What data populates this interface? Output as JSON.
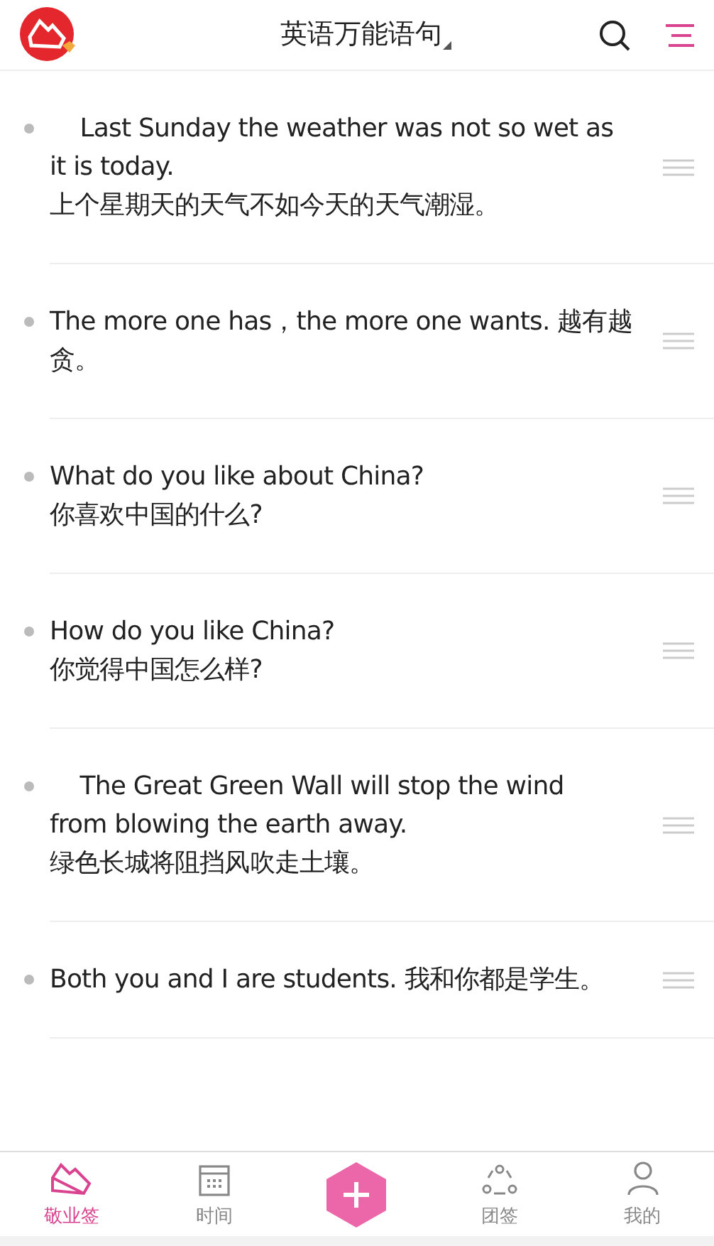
{
  "header": {
    "title": "英语万能语句"
  },
  "notes": [
    {
      "text": "    Last Sunday the weather was not so wet as\nit is today.\n上个星期天的天气不如今天的天气潮湿。"
    },
    {
      "text": "The more one has，the more one wants. 越有越贪。"
    },
    {
      "text": "What do you like about China?\n你喜欢中国的什么?"
    },
    {
      "text": "How do you like China?\n你觉得中国怎么样?"
    },
    {
      "text": "    The Great Green Wall will stop the wind\nfrom blowing the earth away.\n绿色长城将阻挡风吹走土壤。"
    },
    {
      "text": "Both you and I are students. 我和你都是学生。"
    }
  ],
  "tabs": [
    {
      "kind": "notes",
      "label": "敬业签",
      "selected": true
    },
    {
      "kind": "calendar",
      "label": "时间",
      "selected": false
    },
    {
      "kind": "add"
    },
    {
      "kind": "group",
      "label": "团签",
      "selected": false
    },
    {
      "kind": "person",
      "label": "我的",
      "selected": false
    }
  ]
}
